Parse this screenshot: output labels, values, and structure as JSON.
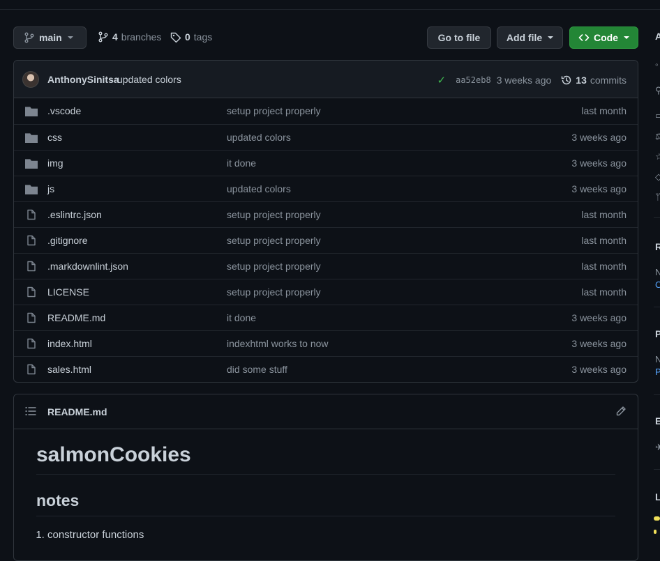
{
  "toolbar": {
    "branch": "main",
    "branches_count": "4",
    "branches_label": "branches",
    "tags_count": "0",
    "tags_label": "tags",
    "goto_file": "Go to file",
    "add_file": "Add file",
    "code": "Code"
  },
  "commit": {
    "author": "AnthonySinitsa",
    "message": "updated colors",
    "sha": "aa52eb8",
    "age": "3 weeks ago",
    "commits_count": "13",
    "commits_label": "commits"
  },
  "files": [
    {
      "type": "folder",
      "name": ".vscode",
      "message": "setup project properly",
      "age": "last month"
    },
    {
      "type": "folder",
      "name": "css",
      "message": "updated colors",
      "age": "3 weeks ago"
    },
    {
      "type": "folder",
      "name": "img",
      "message": "it done",
      "age": "3 weeks ago"
    },
    {
      "type": "folder",
      "name": "js",
      "message": "updated colors",
      "age": "3 weeks ago"
    },
    {
      "type": "file",
      "name": ".eslintrc.json",
      "message": "setup project properly",
      "age": "last month"
    },
    {
      "type": "file",
      "name": ".gitignore",
      "message": "setup project properly",
      "age": "last month"
    },
    {
      "type": "file",
      "name": ".markdownlint.json",
      "message": "setup project properly",
      "age": "last month"
    },
    {
      "type": "file",
      "name": "LICENSE",
      "message": "setup project properly",
      "age": "last month"
    },
    {
      "type": "file",
      "name": "README.md",
      "message": "it done",
      "age": "3 weeks ago"
    },
    {
      "type": "file",
      "name": "index.html",
      "message": "indexhtml works to now",
      "age": "3 weeks ago"
    },
    {
      "type": "file",
      "name": "sales.html",
      "message": "did some stuff",
      "age": "3 weeks ago"
    }
  ],
  "readme": {
    "filename": "README.md",
    "h1": "salmonCookies",
    "h2": "notes",
    "list": [
      "constructor functions"
    ]
  },
  "sidebar": {
    "about_initial": "A",
    "releases_initial": "R",
    "releases_text": "N",
    "releases_link": "C",
    "packages_initial": "P",
    "packages_text": "N",
    "packages_link": "P",
    "env_initial": "E",
    "languages_initial": "L"
  },
  "colors": {
    "background": "#0d1117",
    "code_button": "#238636",
    "check": "#3fb950",
    "link": "#58a6ff"
  }
}
